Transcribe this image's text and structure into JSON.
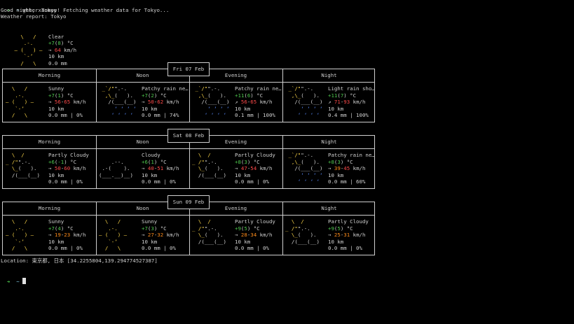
{
  "colors": {
    "background": "#000000",
    "text": "#d0d0d0",
    "prompt_green": "#4ec94e",
    "temp_green": "#4ec94e",
    "wind_red": "#ff4a4a",
    "wind_orange": "#ff8c1a",
    "sun_yellow": "#ffd94a",
    "rain_blue": "#5a8cff",
    "border": "#cfcfcf"
  },
  "terminal": {
    "prompt_symbol": "➜",
    "prompt_tilde": "~",
    "command": "wther Tokyo",
    "greeting": "Good night, xanmoy! Fetching weather data for Tokyo...",
    "report_title": "Weather report: Tokyo"
  },
  "current": {
    "condition": "Clear",
    "temp": "+7",
    "feels": "8",
    "temp_unit": "°C",
    "wind_arrow": "→",
    "wind_speed": "64",
    "wind_unit": "km/h",
    "visibility": "10 km",
    "precip": "0.0 mm",
    "art": [
      "   \\   /   ",
      "    .-.    ",
      " ‒ (   ) ‒ ",
      "    `-’    ",
      "   /   \\   "
    ]
  },
  "periods": [
    "Morning",
    "Noon",
    "Evening",
    "Night"
  ],
  "days": [
    {
      "label": "Fri 07 Feb",
      "slots": [
        {
          "art_kind": "sunny",
          "condition": "Sunny",
          "temp": "+7(1) °C",
          "wind": "→ 56-65 km/h",
          "visibility": "10 km",
          "precip": "0.0 mm | 0%"
        },
        {
          "art_kind": "rain",
          "condition": "Patchy rain ne…",
          "temp": "+7(2) °C",
          "wind": "→ 50-62 km/h",
          "visibility": "10 km",
          "precip": "0.0 mm | 74%"
        },
        {
          "art_kind": "rain",
          "condition": "Patchy rain ne…",
          "temp": "+11(6) °C",
          "wind": "↗ 56-65 km/h",
          "visibility": "10 km",
          "precip": "0.1 mm | 100%"
        },
        {
          "art_kind": "rain",
          "condition": "Light rain sho…",
          "temp": "+11(7) °C",
          "wind": "↗ 71-93 km/h",
          "visibility": "10 km",
          "precip": "0.4 mm | 100%"
        }
      ]
    },
    {
      "label": "Sat 08 Feb",
      "slots": [
        {
          "art_kind": "partly",
          "condition": "Partly Cloudy",
          "temp": "+6(-1) °C",
          "wind": "→ 50-60 km/h",
          "visibility": "10 km",
          "precip": "0.0 mm | 0%"
        },
        {
          "art_kind": "cloudy",
          "condition": "Cloudy",
          "temp": "+6(1) °C",
          "wind": "→ 40-51 km/h",
          "visibility": "10 km",
          "precip": "0.0 mm | 0%"
        },
        {
          "art_kind": "partly",
          "condition": "Partly Cloudy",
          "temp": "+8(3) °C",
          "wind": "→ 47-54 km/h",
          "visibility": "10 km",
          "precip": "0.0 mm | 0%"
        },
        {
          "art_kind": "rain",
          "condition": "Patchy rain ne…",
          "temp": "+8(3) °C",
          "wind": "→ 39-45 km/h",
          "visibility": "10 km",
          "precip": "0.0 mm | 60%"
        }
      ]
    },
    {
      "label": "Sun 09 Feb",
      "slots": [
        {
          "art_kind": "sunny",
          "condition": "Sunny",
          "temp": "+7(4) °C",
          "wind": "→ 19-23 km/h",
          "visibility": "10 km",
          "precip": "0.0 mm | 0%"
        },
        {
          "art_kind": "sunny",
          "condition": "Sunny",
          "temp": "+7(3) °C",
          "wind": "→ 27-32 km/h",
          "visibility": "10 km",
          "precip": "0.0 mm | 0%"
        },
        {
          "art_kind": "partly",
          "condition": "Partly Cloudy",
          "temp": "+9(5) °C",
          "wind": "→ 28-34 km/h",
          "visibility": "10 km",
          "precip": "0.0 mm | 0%"
        },
        {
          "art_kind": "partly",
          "condition": "Partly Cloudy",
          "temp": "+9(5) °C",
          "wind": "→ 25-31 km/h",
          "visibility": "10 km",
          "precip": "0.0 mm | 0%"
        }
      ]
    }
  ],
  "art": {
    "sunny": [
      "  \\   /  ",
      "   .-.   ",
      "‒ (   ) ‒",
      "   `-’   ",
      "  /   \\  "
    ],
    "partly": [
      "  \\  /   ",
      "_ /\"\".-.  ",
      "  \\_(   ).",
      "  /(___(__)",
      "          "
    ],
    "cloudy": [
      "          ",
      "    .--.  ",
      " .-(    ). ",
      "(___.__)__)",
      "          "
    ],
    "rain": [
      " _`/\"\".-.  ",
      "  ,\\_(   ). ",
      "   /(___(__)",
      "     ‘ ‘ ‘ ‘",
      "    ‘ ‘ ‘ ‘ "
    ]
  },
  "location": "Location: 東京都, 日本 [34.2255804,139.294774527387]"
}
